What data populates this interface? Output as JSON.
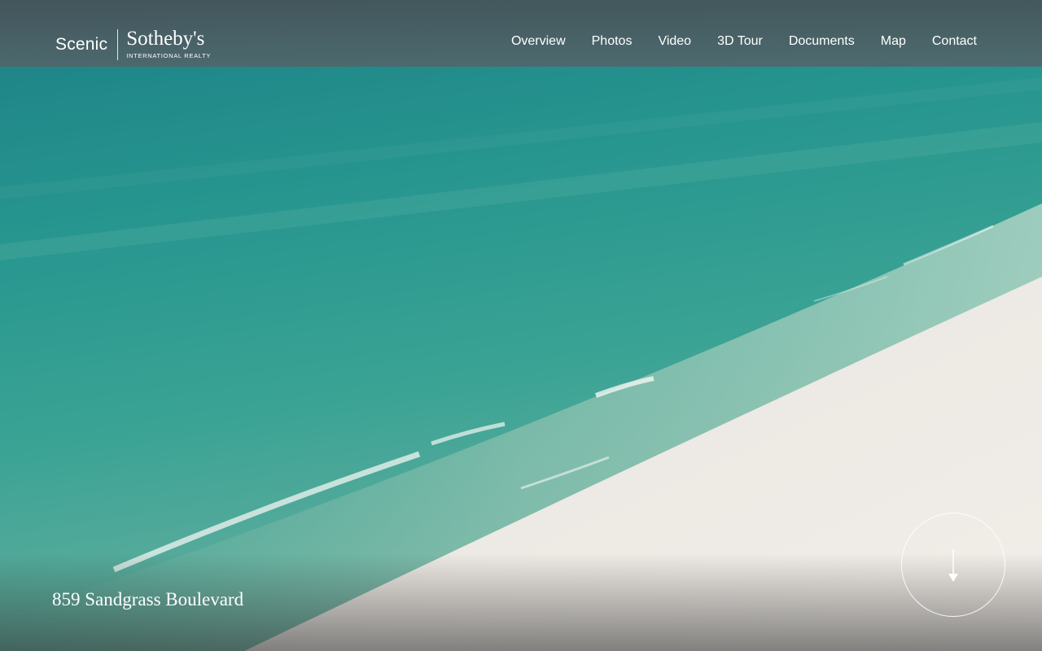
{
  "logo": {
    "brand": "Scenic",
    "partner": "Sotheby's",
    "tagline": "INTERNATIONAL REALTY"
  },
  "nav": {
    "items": [
      {
        "label": "Overview"
      },
      {
        "label": "Photos"
      },
      {
        "label": "Video"
      },
      {
        "label": "3D Tour"
      },
      {
        "label": "Documents"
      },
      {
        "label": "Map"
      },
      {
        "label": "Contact"
      }
    ]
  },
  "hero": {
    "address": "859 Sandgrass Boulevard",
    "scroll_icon": "arrow-down-icon"
  },
  "colors": {
    "header_bg": "#4f5960",
    "text": "#ffffff",
    "sea_deep": "#1f8a8c",
    "sea_shallow": "#7fc2b2",
    "sand": "#ece6e0"
  }
}
